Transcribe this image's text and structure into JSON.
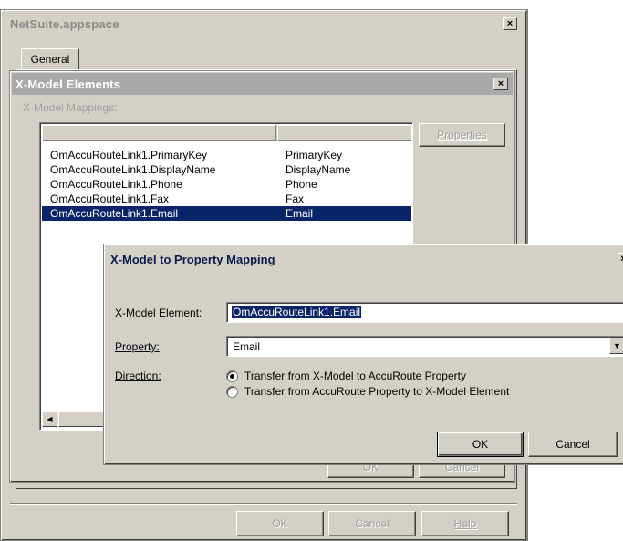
{
  "outer": {
    "title": "NetSuite.appspace",
    "close": "×",
    "tab_general": "General",
    "buttons": {
      "ok": "OK",
      "cancel": "Cancel",
      "help": "Help"
    }
  },
  "xmodel": {
    "title": "X-Model Elements",
    "close": "×",
    "mappings_label": "X-Model Mappings:",
    "properties_button": "Properties",
    "rows": [
      {
        "element": "OmAccuRouteLink1.PrimaryKey",
        "property": "PrimaryKey"
      },
      {
        "element": "OmAccuRouteLink1.DisplayName",
        "property": "DisplayName"
      },
      {
        "element": "OmAccuRouteLink1.Phone",
        "property": "Phone"
      },
      {
        "element": "OmAccuRouteLink1.Fax",
        "property": "Fax"
      },
      {
        "element": "OmAccuRouteLink1.Email",
        "property": "Email"
      }
    ],
    "scroll_left": "◀",
    "hidden_ok": "OK",
    "hidden_cancel": "Cancel"
  },
  "mapping": {
    "title": "X-Model to Property Mapping",
    "close": "×",
    "element_label": "X-Model Element:",
    "element_value": "OmAccuRouteLink1.Email",
    "property_label": "Property:",
    "property_value": "Email",
    "direction_label": "Direction:",
    "option1": "Transfer from X-Model to AccuRoute Property",
    "option2": "Transfer from AccuRoute Property to X-Model Element",
    "ok": "OK",
    "cancel": "Cancel"
  }
}
